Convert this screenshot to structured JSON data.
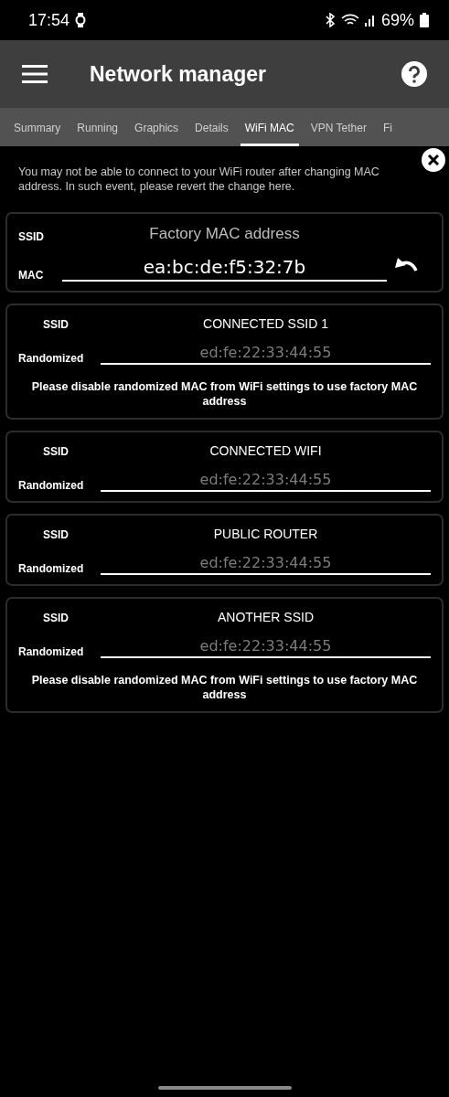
{
  "status_bar": {
    "time": "17:54",
    "battery": "69%"
  },
  "app_bar": {
    "title": "Network manager"
  },
  "tabs": [
    {
      "label": "Summary",
      "selected": false
    },
    {
      "label": "Running",
      "selected": false
    },
    {
      "label": "Graphics",
      "selected": false
    },
    {
      "label": "Details",
      "selected": false
    },
    {
      "label": "WiFi MAC",
      "selected": true
    },
    {
      "label": "VPN Tether",
      "selected": false
    },
    {
      "label": "Fi",
      "selected": false
    }
  ],
  "notice": {
    "text": "You may not be able to connect to your WiFi router after changing MAC address. In such event, please revert the change here."
  },
  "factory": {
    "ssid_label": "SSID",
    "ssid_value": "Factory MAC address",
    "mac_label": "MAC",
    "mac_value": "ea:bc:de:f5:32:7b"
  },
  "networks": [
    {
      "ssid_label": "SSID",
      "ssid": "CONNECTED SSID 1",
      "mac_label": "Randomized",
      "placeholder": "ed:fe:22:33:44:55",
      "note": "Please disable randomized MAC from WiFi settings to use factory MAC address"
    },
    {
      "ssid_label": "SSID",
      "ssid": "CONNECTED WIFI",
      "mac_label": "Randomized",
      "placeholder": "ed:fe:22:33:44:55"
    },
    {
      "ssid_label": "SSID",
      "ssid": "PUBLIC ROUTER",
      "mac_label": "Randomized",
      "placeholder": "ed:fe:22:33:44:55"
    },
    {
      "ssid_label": "SSID",
      "ssid": "ANOTHER SSID",
      "mac_label": "Randomized",
      "placeholder": "ed:fe:22:33:44:55",
      "note": "Please disable randomized MAC from WiFi settings to use factory MAC address"
    }
  ]
}
